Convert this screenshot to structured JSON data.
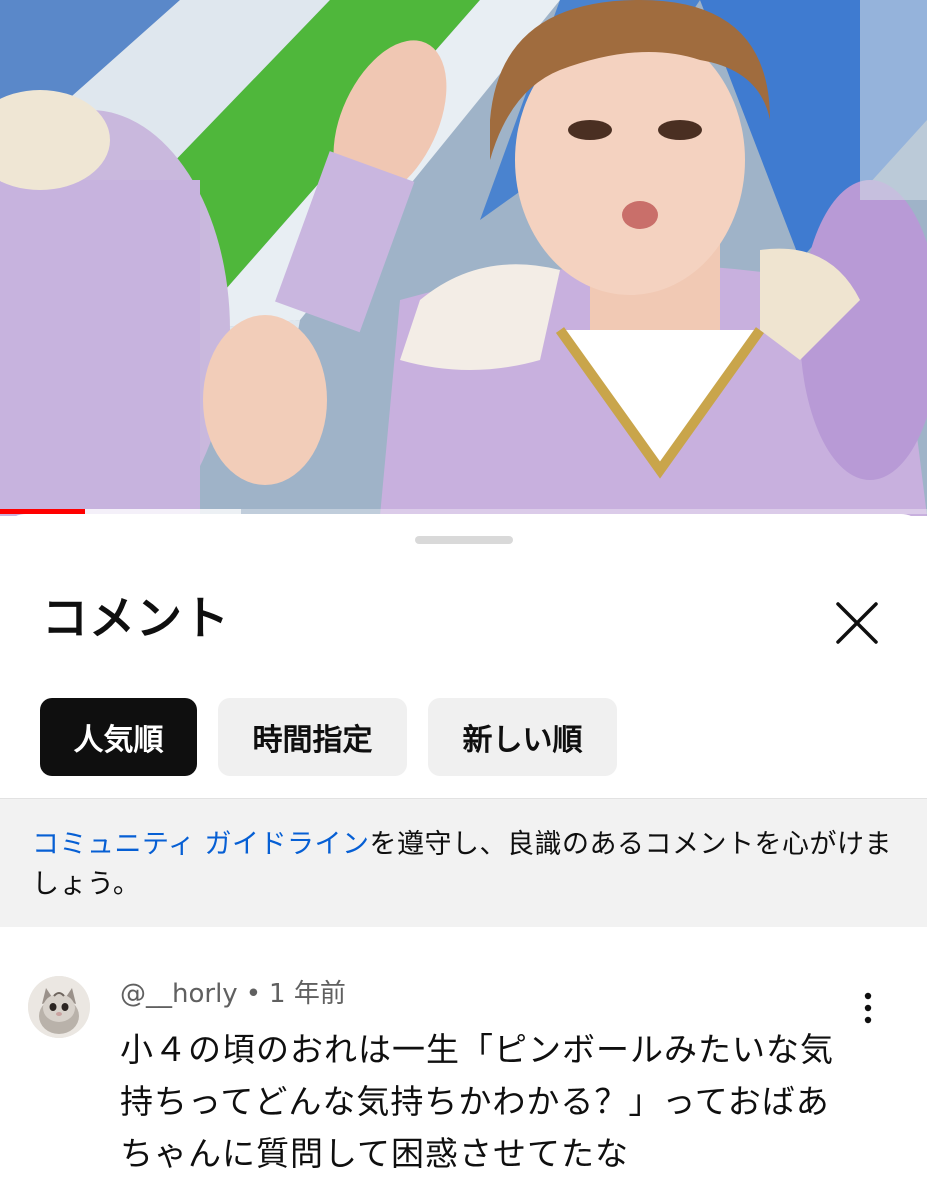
{
  "video": {
    "progress_played": 0.092,
    "progress_buffered": 0.26
  },
  "comments_panel": {
    "title": "コメント",
    "close_icon": "close-icon",
    "sort_chips": [
      {
        "label": "人気順",
        "active": true
      },
      {
        "label": "時間指定",
        "active": false
      },
      {
        "label": "新しい順",
        "active": false
      }
    ],
    "guideline": {
      "link_text": "コミュニティ ガイドライン",
      "text": "を遵守し、良識のあるコメントを心がけましょう。"
    }
  },
  "comment": {
    "author": "@__horly",
    "separator": "•",
    "time": "1 年前",
    "text": "小４の頃のおれは一生「ピンボールみたいな気持ちってどんな気持ちかわかる？」っておばあちゃんに質問して困惑させてたな",
    "avatar_icon": "kitten-avatar",
    "menu_icon": "more-vertical-icon"
  },
  "colors": {
    "accent_link": "#065fd4",
    "progress_red": "#ff0000",
    "chip_active_bg": "#0f0f0f",
    "chip_bg": "#f0f0f0"
  }
}
